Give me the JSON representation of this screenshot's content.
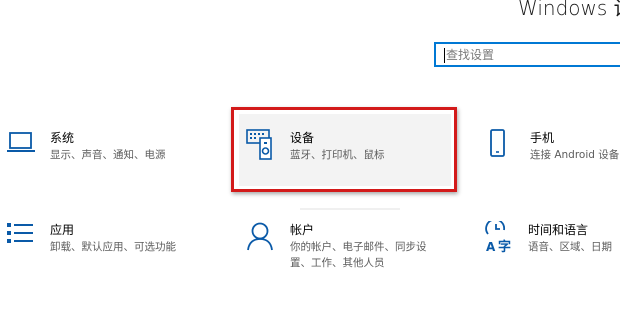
{
  "window": {
    "title": "Windows 设"
  },
  "search": {
    "placeholder": "查找设置"
  },
  "tiles": [
    {
      "name": "系统",
      "desc": "显示、声音、通知、电源",
      "icon": "laptop-icon"
    },
    {
      "name": "设备",
      "desc": "蓝牙、打印机、鼠标",
      "icon": "devices-icon"
    },
    {
      "name": "手机",
      "desc": "连接 Android 设备",
      "icon": "phone-icon"
    },
    {
      "name": "应用",
      "desc": "卸载、默认应用、可选功能",
      "icon": "apps-icon"
    },
    {
      "name": "帐户",
      "desc": "你的帐户、电子邮件、同步设置、工作、其他人员",
      "icon": "person-icon"
    },
    {
      "name": "时间和语言",
      "desc": "语音、区域、日期",
      "icon": "time-language-icon"
    }
  ],
  "colors": {
    "accent": "#0078d4",
    "highlight": "#d31a1a"
  }
}
